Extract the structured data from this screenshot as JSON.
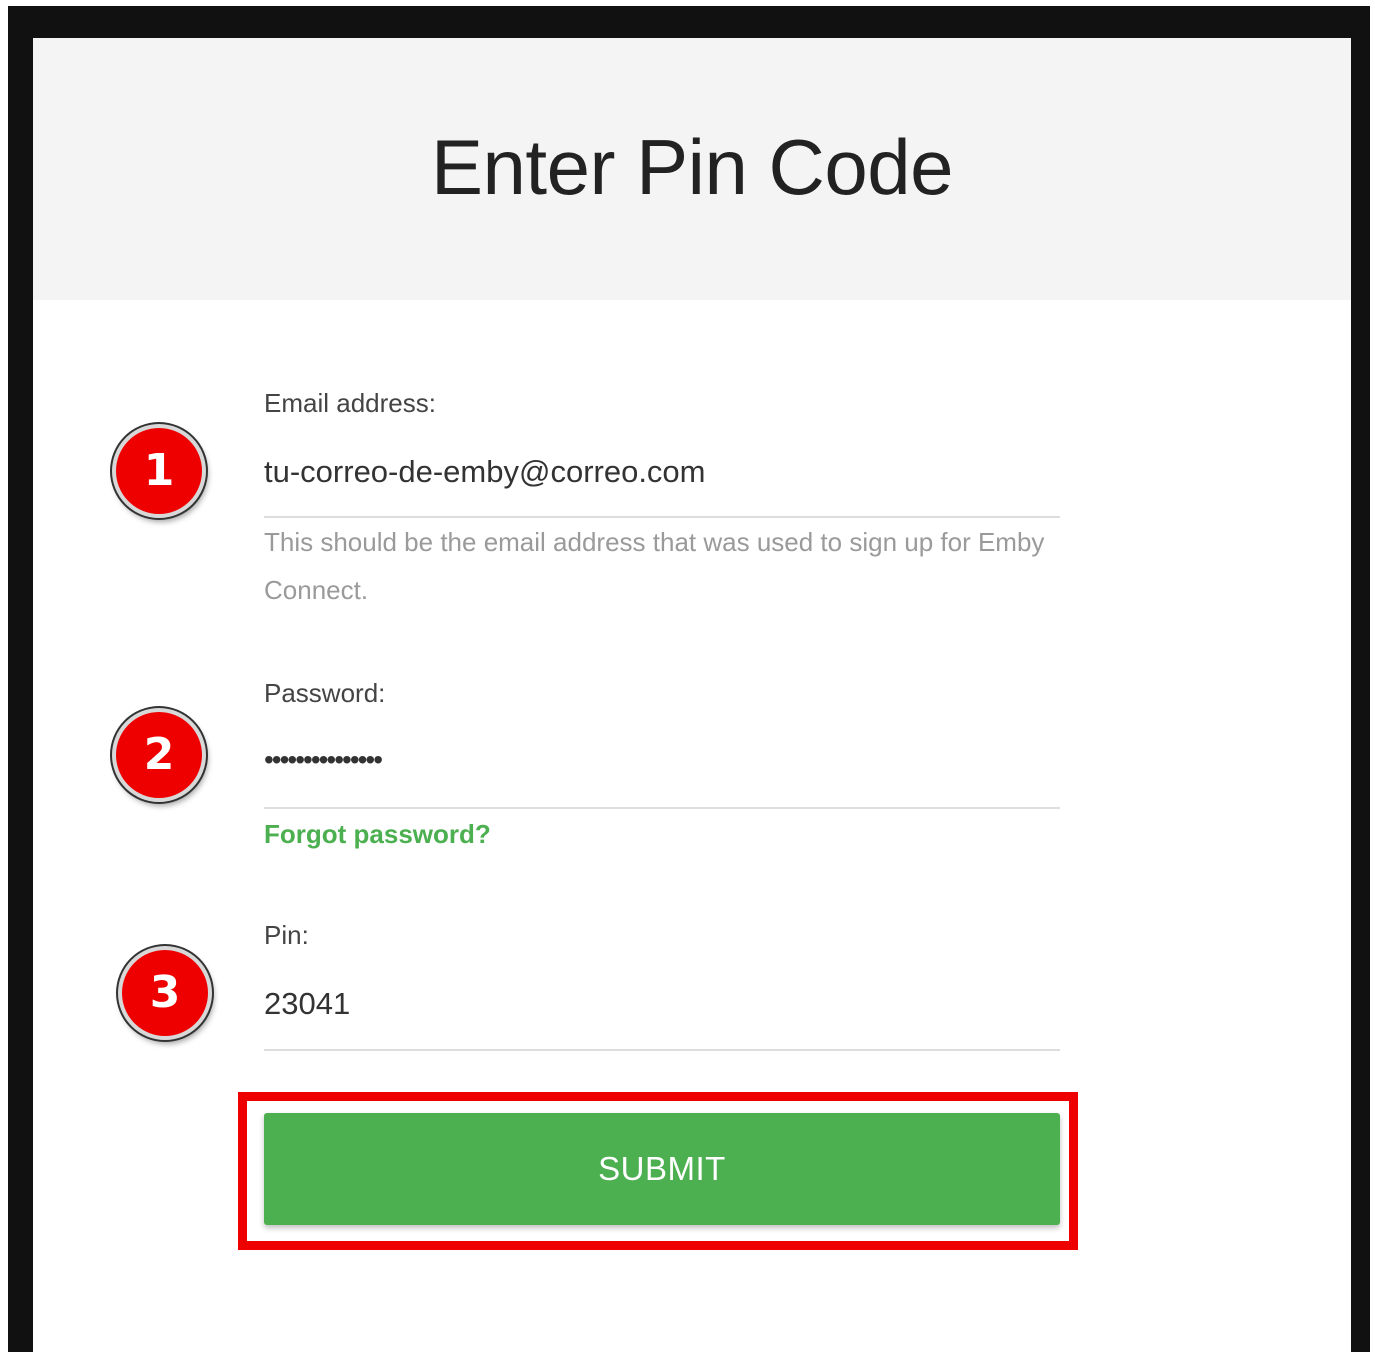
{
  "header": {
    "title": "Enter Pin Code"
  },
  "email": {
    "label": "Email address:",
    "value": "tu-correo-de-emby@correo.com",
    "helper": "This should be the email address that was used to sign up for Emby Connect."
  },
  "password": {
    "label": "Password:",
    "value": "•••••••••••••••",
    "forgot_link": "Forgot password?"
  },
  "pin": {
    "label": "Pin:",
    "value": "23041"
  },
  "submit": {
    "label": "SUBMIT"
  },
  "annotations": {
    "badge_1": "1",
    "badge_2": "2",
    "badge_3": "3"
  },
  "colors": {
    "accent": "#4caf50",
    "annotation_red": "#ee0000",
    "header_bg": "#f4f4f4",
    "frame": "#111111"
  }
}
